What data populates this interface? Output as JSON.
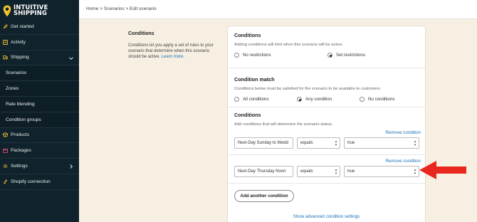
{
  "brand": {
    "name_line1": "INTUITIVE",
    "name_line2": "SHIPPING",
    "accent": "#f2c230"
  },
  "sidebar": {
    "items": [
      {
        "label": "Get started",
        "icon": "rocket-icon",
        "sub": false
      },
      {
        "label": "Activity",
        "icon": "activity-icon",
        "sub": false
      },
      {
        "label": "Shipping",
        "icon": "truck-icon",
        "sub": false,
        "expanded": true
      },
      {
        "label": "Scenarios",
        "sub": true
      },
      {
        "label": "Zones",
        "sub": true
      },
      {
        "label": "Rate blending",
        "sub": true
      },
      {
        "label": "Condition groups",
        "sub": true
      },
      {
        "label": "Products",
        "icon": "box-icon",
        "sub": false
      },
      {
        "label": "Packages",
        "icon": "package-icon",
        "sub": false
      },
      {
        "label": "Settings",
        "icon": "gear-icon",
        "sub": false
      },
      {
        "label": "Shopify connection",
        "icon": "link-icon",
        "sub": false
      }
    ]
  },
  "header": {
    "breadcrumb": "Home > Scenarios > Edit scenario"
  },
  "description": {
    "title": "Conditions",
    "body": "Conditions let you apply a set of rules to your scenario that determine when this scenario should be active.",
    "link": "Learn more."
  },
  "conditions_section": {
    "title": "Conditions",
    "subtitle": "Adding conditions will limit when this scenario will be active.",
    "options": [
      "No restrictions",
      "Set restrictions"
    ],
    "selected": "Set restrictions"
  },
  "condition_match": {
    "title": "Condition match",
    "subtitle": "Conditions below must be satisfied for the scenario to be available to customers.",
    "options": [
      "All conditions",
      "Any condition",
      "No conditions"
    ],
    "selected": "Any condition"
  },
  "conditions_list": {
    "title": "Conditions",
    "subtitle": "Add conditions that will determine the scenario status.",
    "remove_label": "Remove condition",
    "rows": [
      {
        "field": "Next-Day Sunday to Wedd",
        "operator": "equals",
        "value": "true"
      },
      {
        "field": "Next-Day Thursday Noon",
        "operator": "equals",
        "value": "true"
      }
    ],
    "add_button": "Add another condition",
    "advanced_link": "Show advanced condition settings"
  },
  "annotation": {
    "arrow_color": "#e8271e"
  }
}
